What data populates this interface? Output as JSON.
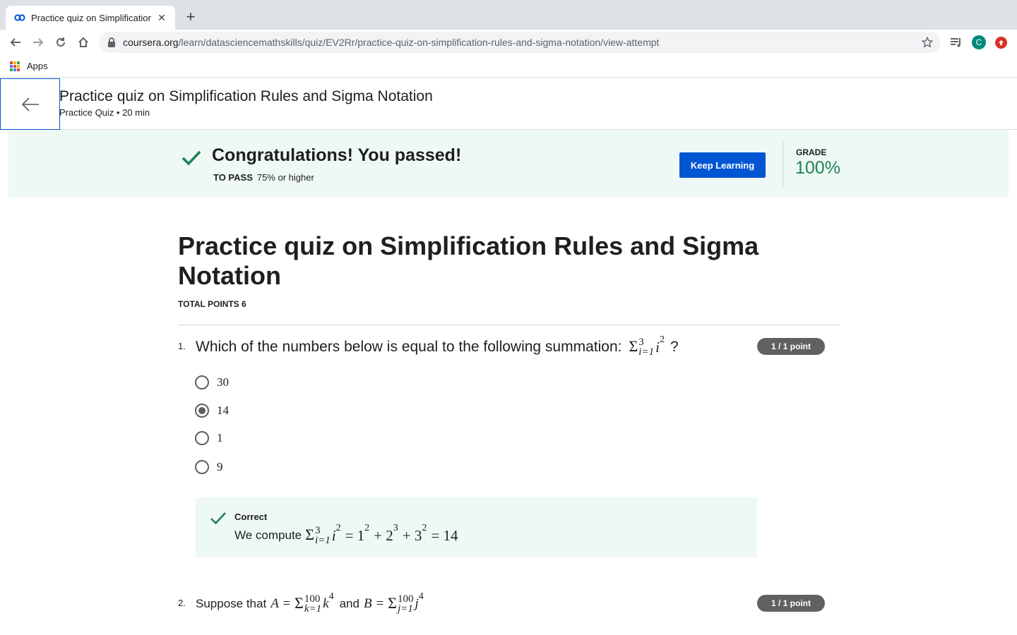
{
  "browser": {
    "tab_title": "Practice quiz on Simplification",
    "url_host": "coursera.org",
    "url_path": "/learn/datasciencemathskills/quiz/EV2Rr/practice-quiz-on-simplification-rules-and-sigma-notation/view-attempt",
    "profile_initial": "C",
    "bookmark_apps": "Apps"
  },
  "header": {
    "title": "Practice quiz on Simplification Rules and Sigma Notation",
    "subtitle": "Practice Quiz • 20 min"
  },
  "banner": {
    "message": "Congratulations! You passed!",
    "to_pass_label": "TO PASS",
    "to_pass_value": "75% or higher",
    "keep_learning": "Keep Learning",
    "grade_label": "GRADE",
    "grade_value": "100%",
    "accent": "#1f8354"
  },
  "quiz": {
    "title": "Practice quiz on Simplification Rules and Sigma Notation",
    "total_points": "TOTAL POINTS 6",
    "questions": [
      {
        "number": "1.",
        "text": "Which of the numbers below is equal to the following summation:",
        "math": {
          "sigma": "Σ",
          "upper": "3",
          "lower": "i=1",
          "term": "i",
          "exp": "2",
          "tail": "?"
        },
        "points": "1 / 1 point",
        "options": [
          "30",
          "14",
          "1",
          "9"
        ],
        "selected_index": 1,
        "feedback": {
          "label": "Correct",
          "prefix": "We compute",
          "math": {
            "sigma": "Σ",
            "upper": "3",
            "lower": "i=1",
            "term": "i",
            "exp": "2",
            "rest1": "= 1",
            "e1": "2",
            "rest2": "+ 2",
            "e2": "3",
            "rest3": "+ 3",
            "e3": "2",
            "rest4": "= 14"
          }
        }
      },
      {
        "number": "2.",
        "text_a": "Suppose that",
        "A": "A =",
        "sigmaA": {
          "sigma": "Σ",
          "upper": "100",
          "lower": "k=1",
          "term": "k",
          "exp": "4"
        },
        "and": "and",
        "B": "B =",
        "sigmaB": {
          "sigma": "Σ",
          "upper": "100",
          "lower": "j=1",
          "term": "j",
          "exp": "4"
        },
        "points": "1 / 1 point"
      }
    ]
  }
}
